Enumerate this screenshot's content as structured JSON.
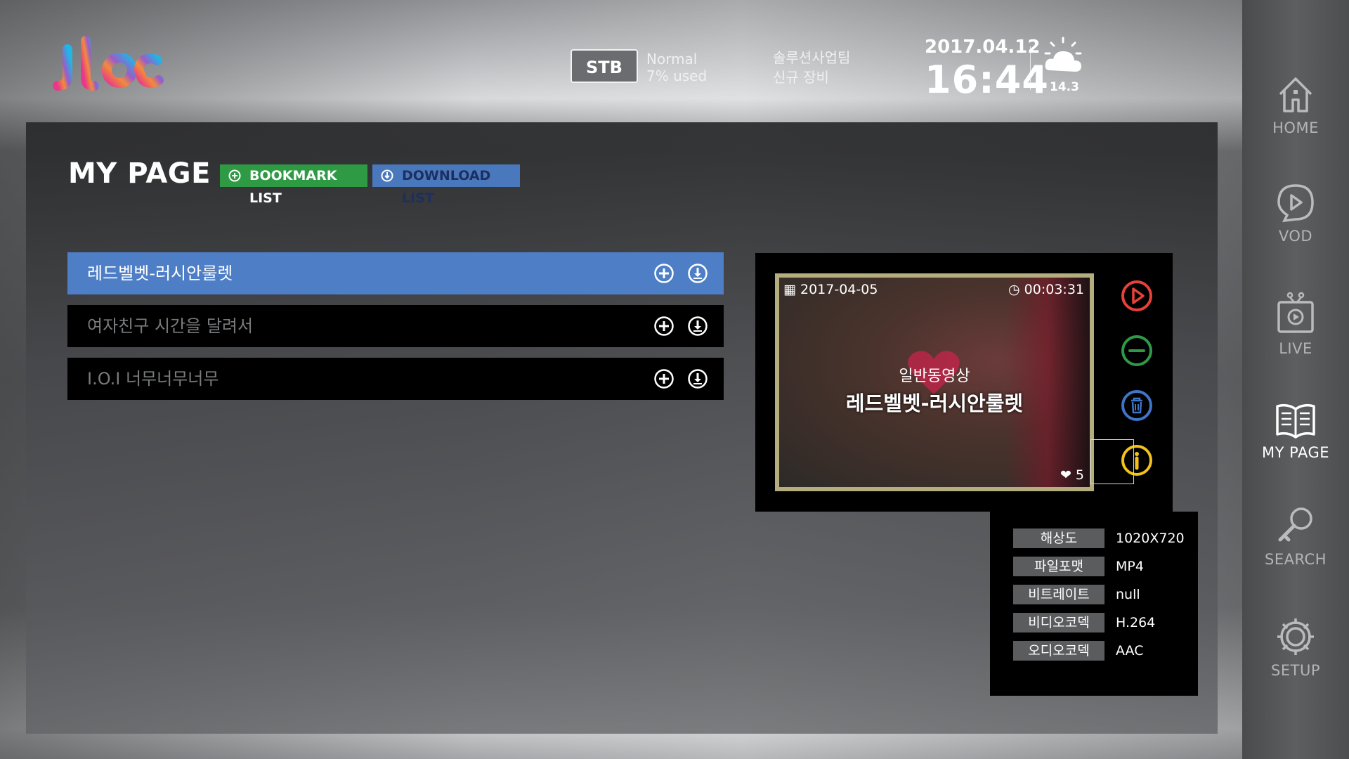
{
  "header": {
    "logo": "jtbc",
    "stb_label": "STB",
    "stb_status": "Normal",
    "stb_usage": "7% used",
    "team_line1": "솔루션사업팀",
    "team_line2": "신규 장비",
    "date": "2017.04.12",
    "time": "16:44",
    "weather_icon": "sun-cloud-icon",
    "temperature": "14.3"
  },
  "sidebar": {
    "items": [
      {
        "label": "HOME",
        "icon": "home-icon",
        "active": false
      },
      {
        "label": "VOD",
        "icon": "play-bubble-icon",
        "active": false
      },
      {
        "label": "LIVE",
        "icon": "tv-live-icon",
        "active": false
      },
      {
        "label": "MY PAGE",
        "icon": "book-icon",
        "active": true
      },
      {
        "label": "SEARCH",
        "icon": "magnifier-icon",
        "active": false
      },
      {
        "label": "SETUP",
        "icon": "gear-icon",
        "active": false
      }
    ]
  },
  "main": {
    "title": "MY PAGE",
    "tabs": [
      {
        "label": "BOOKMARK LIST",
        "color": "#2f9a44"
      },
      {
        "label": "DOWNLOAD LIST",
        "color": "#4a78bd"
      }
    ],
    "list": [
      {
        "title": "레드벨벳-러시안룰렛",
        "selected": true
      },
      {
        "title": "여자친구 시간을 달려서",
        "selected": false
      },
      {
        "title": "I.O.I 너무너무너무",
        "selected": false
      }
    ]
  },
  "preview": {
    "date": "2017-04-05",
    "duration": "00:03:31",
    "category": "일반동영상",
    "title": "레드벨벳-러시안룰렛",
    "likes": "5",
    "controls": [
      "play-icon",
      "minus-icon",
      "trash-icon",
      "info-icon"
    ]
  },
  "details": [
    {
      "label": "해상도",
      "value": "1020X720"
    },
    {
      "label": "파일포맷",
      "value": "MP4"
    },
    {
      "label": "비트레이트",
      "value": "null"
    },
    {
      "label": "비디오코덱",
      "value": "H.264"
    },
    {
      "label": "오디오코덱",
      "value": "AAC"
    }
  ],
  "colors": {
    "accent_blue": "#4e7fc6",
    "bookmark_green": "#2f9a44",
    "play_red": "#e8413a",
    "minus_green": "#2e9a47",
    "trash_blue": "#3f74c6",
    "info_yellow": "#f2c21b"
  }
}
